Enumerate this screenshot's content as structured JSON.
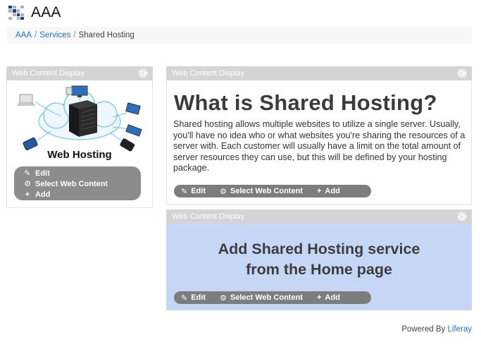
{
  "site": {
    "title": "AAA"
  },
  "breadcrumb": {
    "items": [
      "AAA",
      "Services",
      "Shared Hosting"
    ],
    "separator": "/"
  },
  "portlets": {
    "image": {
      "title": "Web Content Display",
      "illustration_text": "Web Hosting",
      "menu": {
        "edit": "Edit",
        "select": "Select Web Content",
        "add": "Add"
      }
    },
    "article": {
      "title": "Web Content Display",
      "heading": "What is Shared Hosting?",
      "body": "Shared hosting allows multiple websites to utilize a single server. Usually, you'll have no idea who or what websites you're sharing the resources of a server with. Each customer will usually have a limit on the total amount of server resources they can use, but this will be defined by your hosting package.",
      "menu": {
        "edit": "Edit",
        "select": "Select Web Content",
        "add": "Add"
      }
    },
    "notice": {
      "title": "Web Content Display",
      "line1": "Add Shared Hosting service",
      "line2": "from the Home page",
      "menu": {
        "edit": "Edit",
        "select": "Select Web Content",
        "add": "Add"
      }
    }
  },
  "footer": {
    "prefix": "Powered By",
    "link": "Liferay"
  },
  "colors": {
    "link": "#1c75c9",
    "portlet_header": "#d4d4d4",
    "notice_bg": "#c6d7f6",
    "menu_bg": "#7d7d7d"
  },
  "icons": [
    "pencil-icon",
    "gear-icon",
    "plus-icon",
    "cloud-icon",
    "server-icon"
  ]
}
